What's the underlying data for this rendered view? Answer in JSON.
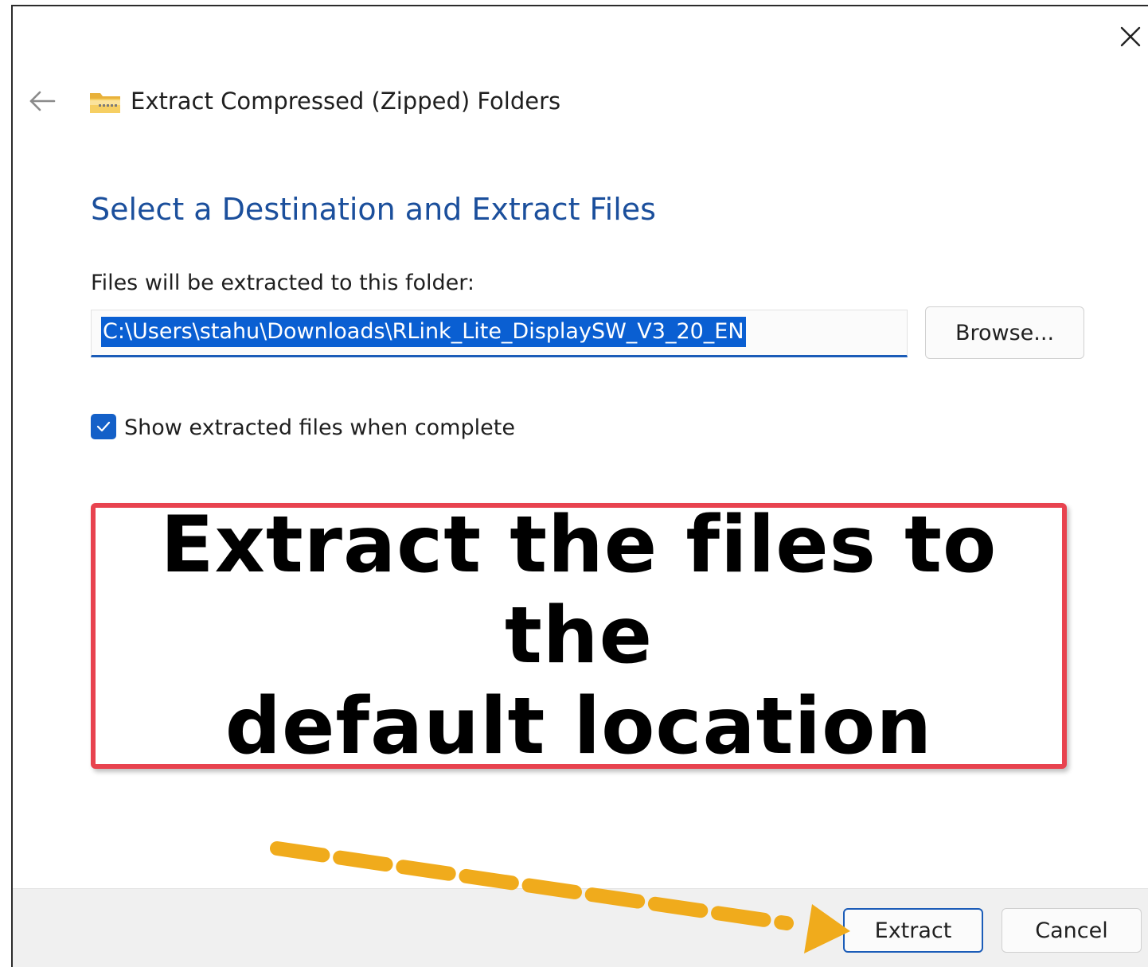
{
  "window": {
    "title": "Extract Compressed (Zipped) Folders",
    "close_icon": "close-icon",
    "back_icon": "back-arrow-icon",
    "folder_icon": "zip-folder-icon"
  },
  "main": {
    "heading": "Select a Destination and Extract Files",
    "folder_label": "Files will be extracted to this folder:",
    "path_value": "C:\\Users\\stahu\\Downloads\\RLink_Lite_DisplaySW_V3_20_EN",
    "browse_label": "Browse...",
    "show_files_checked": true,
    "show_files_label": "Show extracted files when complete"
  },
  "annotation": {
    "line1": "Extract the files to the",
    "line2": "default location",
    "border_color": "#e8434f",
    "arrow_color": "#f0ab1c"
  },
  "footer": {
    "extract_label": "Extract",
    "cancel_label": "Cancel"
  },
  "colors": {
    "accent": "#1b5cb8",
    "heading": "#1b4f9c",
    "selection": "#0a5fd2"
  }
}
